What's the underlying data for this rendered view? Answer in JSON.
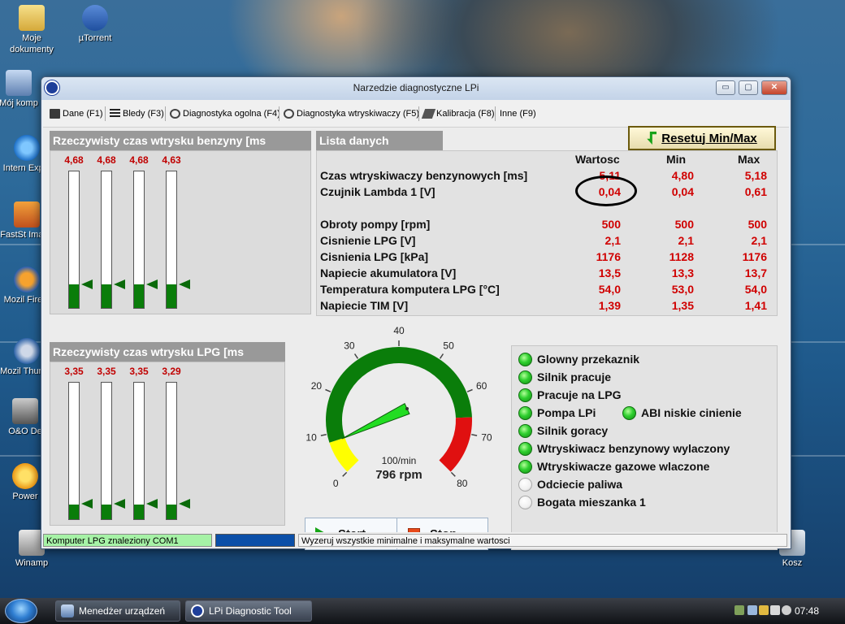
{
  "desktop": {
    "icons": [
      {
        "label": "Moje dokumenty",
        "icon": "folder-icon"
      },
      {
        "label": "µTorrent",
        "icon": "utorrent-icon"
      },
      {
        "label": "Mój komp",
        "icon": "computer-icon"
      },
      {
        "label": "Intern Explo",
        "icon": "internet-explorer-icon"
      },
      {
        "label": "FastSt Image",
        "icon": "faststone-icon"
      },
      {
        "label": "Mozil Firefo",
        "icon": "firefox-icon"
      },
      {
        "label": "Mozil Thunde",
        "icon": "thunderbird-icon"
      },
      {
        "label": "O&O De",
        "icon": "oo-defrag-icon"
      },
      {
        "label": "Power",
        "icon": "power-icon"
      },
      {
        "label": "Winamp",
        "icon": "winamp-icon"
      },
      {
        "label": "Kosz",
        "icon": "recycle-bin-icon"
      }
    ]
  },
  "window": {
    "title": "Narzedzie diagnostyczne LPi",
    "controls": {
      "minimize": "▭",
      "maximize": "▢",
      "close": "✕"
    }
  },
  "menu": {
    "items": [
      {
        "label": "Dane (F1)",
        "icon": "save-icon"
      },
      {
        "label": "Bledy (F3)",
        "icon": "list-icon"
      },
      {
        "label": "Diagnostyka ogolna (F4)",
        "icon": "stethoscope-icon"
      },
      {
        "label": "Diagnostyka wtryskiwaczy (F5)",
        "icon": "stethoscope-icon"
      },
      {
        "label": "Kalibracja (F8)",
        "icon": "calibration-icon"
      },
      {
        "label": "Inne (F9)",
        "icon": ""
      }
    ]
  },
  "petrol_panel": {
    "title": "Rzeczywisty czas wtrysku benzyny [ms",
    "bars": [
      {
        "label": "4,68",
        "fill": 0.17
      },
      {
        "label": "4,68",
        "fill": 0.17
      },
      {
        "label": "4,68",
        "fill": 0.17
      },
      {
        "label": "4,63",
        "fill": 0.17
      }
    ]
  },
  "lpg_panel": {
    "title": "Rzeczywisty czas wtrysku LPG [ms",
    "bars": [
      {
        "label": "3,35",
        "fill": 0.11
      },
      {
        "label": "3,35",
        "fill": 0.11
      },
      {
        "label": "3,35",
        "fill": 0.11
      },
      {
        "label": "3,29",
        "fill": 0.11
      }
    ]
  },
  "data_list": {
    "title": "Lista danych",
    "reset_label": "Resetuj Min/Max",
    "headers": {
      "value": "Wartosc",
      "min": "Min",
      "max": "Max"
    },
    "rows": [
      {
        "name": "Czas wtryskiwaczy benzynowych [ms]",
        "value": "5,11",
        "min": "4,80",
        "max": "5,18"
      },
      {
        "name": "Czujnik Lambda 1 [V]",
        "value": "0,04",
        "min": "0,04",
        "max": "0,61"
      },
      {
        "name": "Obroty pompy [rpm]",
        "value": "500",
        "min": "500",
        "max": "500"
      },
      {
        "name": "Cisnienie LPG [V]",
        "value": "2,1",
        "min": "2,1",
        "max": "2,1"
      },
      {
        "name": "Cisnienia LPG [kPa]",
        "value": "1176",
        "min": "1128",
        "max": "1176"
      },
      {
        "name": "Napiecie akumulatora [V]",
        "value": "13,5",
        "min": "13,3",
        "max": "13,7"
      },
      {
        "name": "Temperatura komputera LPG [°C]",
        "value": "54,0",
        "min": "53,0",
        "max": "54,0"
      },
      {
        "name": "Napiecie TIM [V]",
        "value": "1,39",
        "min": "1,35",
        "max": "1,41"
      }
    ]
  },
  "gauge": {
    "ticks": [
      "0",
      "10",
      "20",
      "30",
      "40",
      "50",
      "60",
      "70",
      "80"
    ],
    "unit": "100/min",
    "reading": "796 rpm",
    "value": 7.96,
    "max": 80,
    "colors": {
      "low": "#ffff00",
      "normal": "#0a7d0a",
      "high": "#e01010",
      "needle": "#22dd22"
    }
  },
  "controls": {
    "start": "Start",
    "stop": "Stop"
  },
  "status_lamps": [
    {
      "label": "Glowny przekaznik",
      "on": true
    },
    {
      "label": "Silnik pracuje",
      "on": true
    },
    {
      "label": "Pracuje na LPG",
      "on": true
    },
    {
      "label": "Pompa LPi",
      "on": true
    },
    {
      "label": "ABI niskie cinienie",
      "on": true
    },
    {
      "label": "Silnik goracy",
      "on": true
    },
    {
      "label": "Wtryskiwacz benzynowy wylaczony",
      "on": true
    },
    {
      "label": "Wtryskiwacze gazowe wlaczone",
      "on": true
    },
    {
      "label": "Odciecie paliwa",
      "on": false
    },
    {
      "label": "Bogata mieszanka 1",
      "on": false
    }
  ],
  "statusbar": {
    "connection": "Komputer LPG znaleziony COM1",
    "hint": "Wyzeruj wszystkie minimalne i maksymalne wartosci"
  },
  "taskbar": {
    "buttons": [
      {
        "label": "Menedżer urządzeń",
        "icon": "device-manager-icon"
      },
      {
        "label": "LPi Diagnostic Tool",
        "icon": "lpi-icon"
      }
    ],
    "clock": "07:48"
  }
}
